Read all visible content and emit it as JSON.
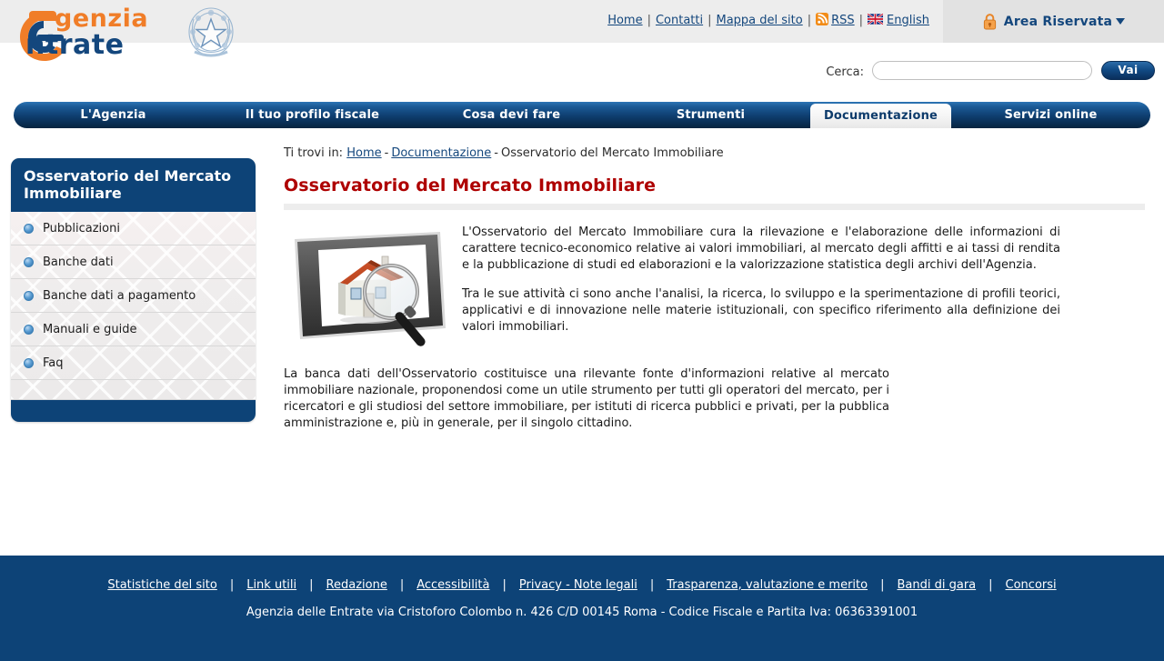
{
  "header": {
    "logo": {
      "line1": "genzia",
      "line2": "ntrate",
      "emblem_icon": "italy-republic-emblem-icon",
      "swoosh_icon": "agenzia-entrate-swoosh-icon"
    },
    "top_links": [
      {
        "label": "Home",
        "icon": null
      },
      {
        "label": "Contatti",
        "icon": null
      },
      {
        "label": "Mappa del sito",
        "icon": null
      },
      {
        "label": "RSS",
        "icon": "rss-icon"
      },
      {
        "label": "English",
        "icon": "uk-flag-icon"
      }
    ],
    "reserved_area": {
      "label": "Area Riservata",
      "lock_icon": "padlock-icon",
      "caret_icon": "chevron-down-icon"
    }
  },
  "search": {
    "label": "Cerca:",
    "value": "",
    "placeholder": "",
    "button_label": "Vai"
  },
  "nav": {
    "items": [
      {
        "label": "L'Agenzia",
        "active": false
      },
      {
        "label": "Il tuo profilo fiscale",
        "active": false
      },
      {
        "label": "Cosa devi fare",
        "active": false
      },
      {
        "label": "Strumenti",
        "active": false
      },
      {
        "label": "Documentazione",
        "active": true
      },
      {
        "label": "Servizi online",
        "active": false
      }
    ]
  },
  "breadcrumb": {
    "prefix": "Ti trovi in:",
    "items": [
      {
        "label": "Home",
        "link": true
      },
      {
        "label": "Documentazione",
        "link": true
      },
      {
        "label": "Osservatorio del Mercato Immobiliare",
        "link": false
      }
    ],
    "separator": "-"
  },
  "sidebar": {
    "title": "Osservatorio del Mercato Immobiliare",
    "items": [
      {
        "label": "Pubblicazioni"
      },
      {
        "label": "Banche dati"
      },
      {
        "label": "Banche dati a pagamento"
      },
      {
        "label": "Manuali e guide"
      },
      {
        "label": "Faq"
      }
    ]
  },
  "main": {
    "title": "Osservatorio del Mercato Immobiliare",
    "image_alt": "tablet-with-house-and-magnifier-illustration",
    "paragraphs": [
      "L'Osservatorio del Mercato Immobiliare cura la rilevazione e l'elaborazione delle informazioni di carattere tecnico-economico relative ai valori immobiliari, al mercato degli affitti e ai tassi di rendita e la pubblicazione di studi ed elaborazioni e la valorizzazione statistica degli archivi dell'Agenzia.",
      "Tra le sue attività ci sono anche l'analisi, la ricerca, lo sviluppo e la sperimentazione di profili teorici, applicativi e di innovazione nelle materie istituzionali, con specifico riferimento alla definizione dei valori immobiliari.",
      "La banca dati dell'Osservatorio costituisce una rilevante fonte d'informazioni relative al mercato immobiliare nazionale, proponendosi come un utile strumento per tutti gli operatori del mercato, per i ricercatori e gli studiosi del settore immobiliare, per istituti di ricerca pubblici e privati, per la pubblica amministrazione e, più in generale, per il singolo cittadino."
    ]
  },
  "footer": {
    "links": [
      {
        "label": "Statistiche del sito"
      },
      {
        "label": "Link utili"
      },
      {
        "label": "Redazione"
      },
      {
        "label": "Accessibilità"
      },
      {
        "label": "Privacy - Note legali"
      },
      {
        "label": "Trasparenza, valutazione e merito"
      },
      {
        "label": "Bandi di gara"
      },
      {
        "label": "Concorsi"
      }
    ],
    "separator": "|",
    "address": "Agenzia delle Entrate via Cristoforo Colombo n. 426 C/D 00145 Roma - Codice Fiscale e Partita Iva: 06363391001"
  },
  "colors": {
    "brand_blue": "#0d4377",
    "brand_orange": "#F07D28",
    "title_red": "#AE0000",
    "header_bg": "#ededed",
    "reserved_bg": "#e2e2e2"
  }
}
